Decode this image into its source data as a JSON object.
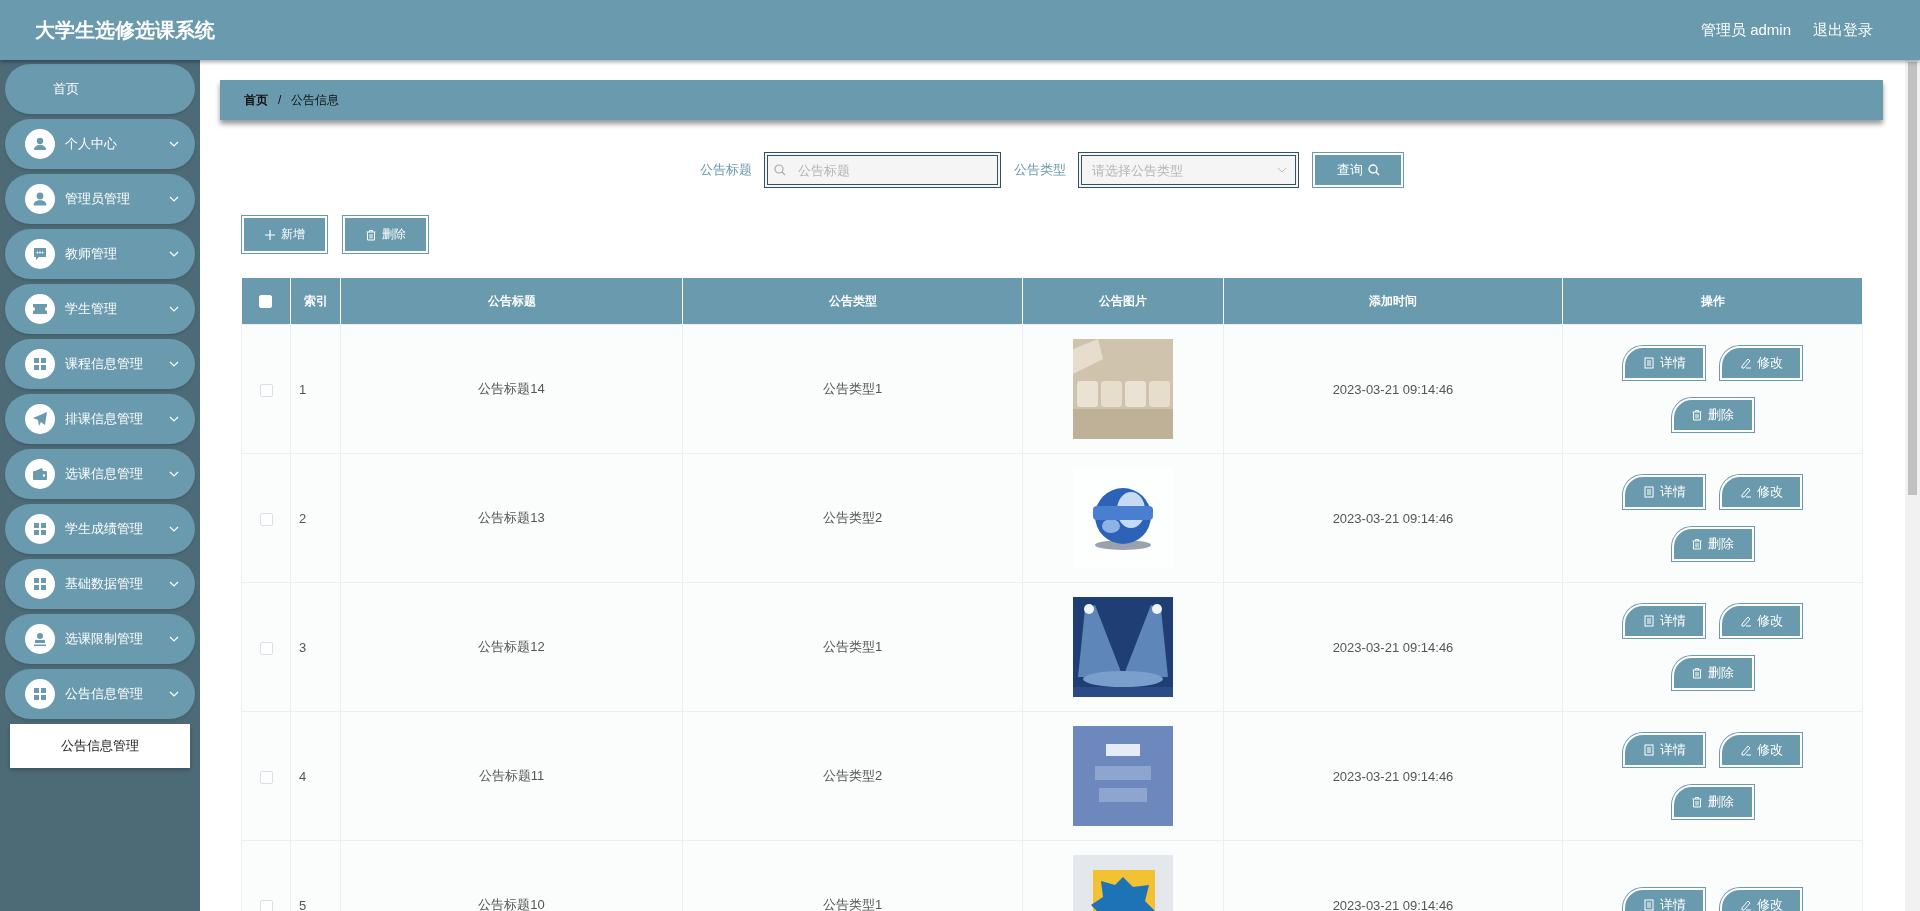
{
  "header": {
    "title": "大学生选修选课系统",
    "user": "管理员 admin",
    "logout": "退出登录"
  },
  "sidebar": {
    "items": [
      {
        "label": "首页",
        "kind": "link"
      },
      {
        "label": "个人中心",
        "kind": "group"
      },
      {
        "label": "管理员管理",
        "kind": "group"
      },
      {
        "label": "教师管理",
        "kind": "group"
      },
      {
        "label": "学生管理",
        "kind": "group"
      },
      {
        "label": "课程信息管理",
        "kind": "group"
      },
      {
        "label": "排课信息管理",
        "kind": "group"
      },
      {
        "label": "选课信息管理",
        "kind": "group"
      },
      {
        "label": "学生成绩管理",
        "kind": "group"
      },
      {
        "label": "基础数据管理",
        "kind": "group"
      },
      {
        "label": "选课限制管理",
        "kind": "group"
      },
      {
        "label": "公告信息管理",
        "kind": "group",
        "children": [
          {
            "label": "公告信息管理",
            "selected": true
          }
        ]
      }
    ]
  },
  "breadcrumb": [
    "首页",
    "/",
    "公告信息"
  ],
  "search": {
    "fields": [
      {
        "label": "公告标题",
        "kind": "text",
        "placeholder": "公告标题"
      },
      {
        "label": "公告类型",
        "kind": "select",
        "placeholder": "请选择公告类型"
      }
    ],
    "button": "查询"
  },
  "toolbar": [
    {
      "label": "新增",
      "kind": "add"
    },
    {
      "label": "删除",
      "kind": "delete"
    }
  ],
  "table": {
    "all_checked": false,
    "columns": [
      "索引",
      "公告标题",
      "公告类型",
      "公告图片",
      "添加时间",
      "操作"
    ],
    "rows": [
      {
        "checked": false,
        "index": "1",
        "title": "公告标题14",
        "type": "公告类型1",
        "image": {
          "kind": "picture"
        },
        "time": "2023-03-21 09:14:46",
        "actions": [
          {
            "label": "详情",
            "kind": "detail"
          },
          {
            "label": "修改",
            "kind": "edit"
          },
          {
            "label": "删除",
            "kind": "delete"
          }
        ]
      },
      {
        "checked": false,
        "index": "2",
        "title": "公告标题13",
        "type": "公告类型2",
        "image": {
          "kind": "picture"
        },
        "time": "2023-03-21 09:14:46",
        "actions": [
          {
            "label": "详情",
            "kind": "detail"
          },
          {
            "label": "修改",
            "kind": "edit"
          },
          {
            "label": "删除",
            "kind": "delete"
          }
        ]
      },
      {
        "checked": false,
        "index": "3",
        "title": "公告标题12",
        "type": "公告类型1",
        "image": {
          "kind": "picture"
        },
        "time": "2023-03-21 09:14:46",
        "actions": [
          {
            "label": "详情",
            "kind": "detail"
          },
          {
            "label": "修改",
            "kind": "edit"
          },
          {
            "label": "删除",
            "kind": "delete"
          }
        ]
      },
      {
        "checked": false,
        "index": "4",
        "title": "公告标题11",
        "type": "公告类型2",
        "image": {
          "kind": "picture"
        },
        "time": "2023-03-21 09:14:46",
        "actions": [
          {
            "label": "详情",
            "kind": "detail"
          },
          {
            "label": "修改",
            "kind": "edit"
          },
          {
            "label": "删除",
            "kind": "delete"
          }
        ]
      },
      {
        "checked": false,
        "index": "5",
        "title": "公告标题10",
        "type": "公告类型1",
        "image": {
          "kind": "picture"
        },
        "time": "2023-03-21 09:14:46",
        "actions": [
          {
            "label": "详情",
            "kind": "detail"
          },
          {
            "label": "修改",
            "kind": "edit"
          }
        ]
      }
    ]
  }
}
